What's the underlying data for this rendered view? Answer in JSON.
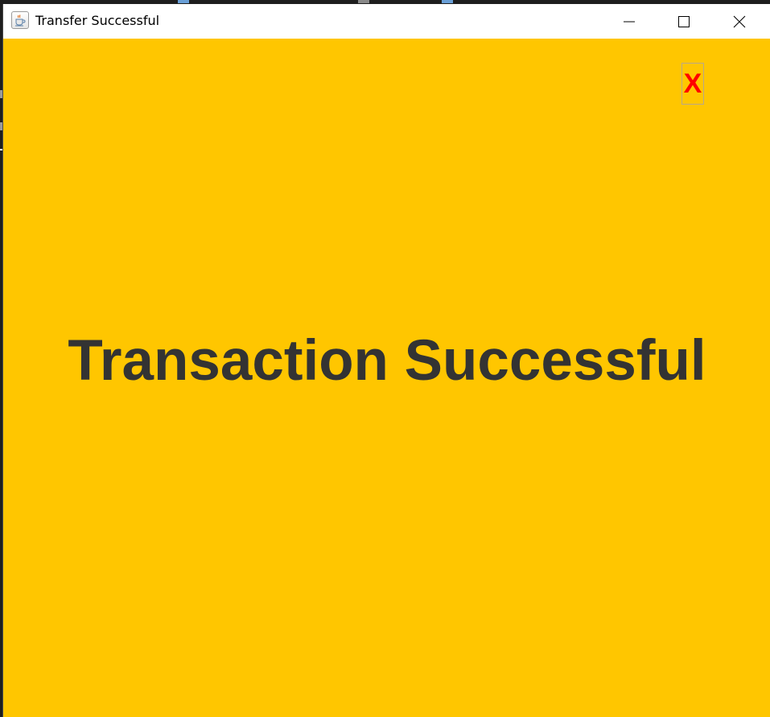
{
  "window": {
    "title": "Transfer Successful",
    "app_icon": "java-cup-icon",
    "controls": {
      "minimize": "minimize-icon",
      "maximize": "maximize-icon",
      "close": "close-icon"
    }
  },
  "content": {
    "dismiss_label": "X",
    "message": "Transaction Successful"
  },
  "colors": {
    "background": "#ffc600",
    "message_text": "#333333",
    "dismiss_text": "#ff0000",
    "titlebar": "#ffffff"
  }
}
